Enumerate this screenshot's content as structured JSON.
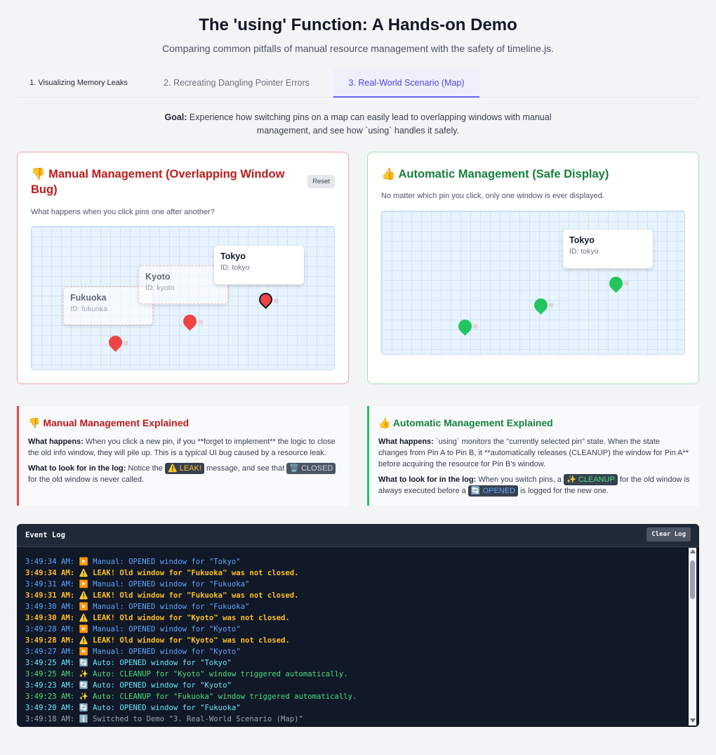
{
  "header": {
    "title": "The 'using' Function: A Hands-on Demo",
    "subtitle": "Comparing common pitfalls of manual resource management with the safety of timeline.js."
  },
  "tabs": [
    {
      "label": "1. Visualizing Memory Leaks",
      "active": false
    },
    {
      "label": "2. Recreating Dangling Pointer Errors",
      "active": false
    },
    {
      "label": "3. Real-World Scenario (Map)",
      "active": true
    }
  ],
  "goal": {
    "label": "Goal:",
    "text": "Experience how switching pins on a map can easily lead to overlapping windows with manual management, and see how `using` handles it safely."
  },
  "manual_card": {
    "icon": "thumbs-down-icon",
    "title": "👎 Manual Management (Overlapping Window Bug)",
    "reset_label": "Reset",
    "description": "What happens when you click pins one after another?",
    "windows": [
      {
        "name": "Fukuoka",
        "id": "ID: fukuoka"
      },
      {
        "name": "Kyoto",
        "id": "ID: kyoto"
      },
      {
        "name": "Tokyo",
        "id": "ID: tokyo"
      }
    ]
  },
  "auto_card": {
    "icon": "thumbs-up-icon",
    "title": "👍 Automatic Management (Safe Display)",
    "description": "No matter which pin you click, only one window is ever displayed.",
    "window": {
      "name": "Tokyo",
      "id": "ID: tokyo"
    }
  },
  "manual_explain": {
    "title": "👎 Manual Management Explained",
    "what_label": "What happens:",
    "what_text": "When you click a new pin, if you **forget to implement** the logic to close the old info window, they will pile up. This is a typical UI bug caused by a resource leak.",
    "look_label": "What to look for in the log:",
    "look_pre": "Notice the",
    "leak_tag": "⚠️ LEAK!",
    "look_mid": "message, and see that",
    "closed_tag": "🗑️ CLOSED",
    "look_post": "for the old window is never called."
  },
  "auto_explain": {
    "title": "👍 Automatic Management Explained",
    "what_label": "What happens:",
    "what_text": "`using` monitors the \"currently selected pin\" state. When the state changes from Pin A to Pin B, it **automatically releases (CLEANUP) the window for Pin A** before acquiring the resource for Pin B's window.",
    "look_label": "What to look for in the log:",
    "look_pre": "When you switch pins, a",
    "cleanup_tag": "✨ CLEANUP",
    "look_mid": "for the old window is always executed before a",
    "opened_tag": "🔄 OPENED",
    "look_post": "is logged for the new one."
  },
  "event_log": {
    "title": "Event Log",
    "clear_label": "Clear Log",
    "entries": [
      {
        "kind": "info",
        "text": "3:49:34 AM: ▶️ Manual: OPENED window for \"Tokyo\""
      },
      {
        "kind": "warn",
        "text": "3:49:34 AM: ⚠️ LEAK! Old window for \"Fukuoka\" was not closed."
      },
      {
        "kind": "info",
        "text": "3:49:31 AM: ▶️ Manual: OPENED window for \"Fukuoka\""
      },
      {
        "kind": "warn",
        "text": "3:49:31 AM: ⚠️ LEAK! Old window for \"Fukuoka\" was not closed."
      },
      {
        "kind": "info",
        "text": "3:49:30 AM: ▶️ Manual: OPENED window for \"Fukuoka\""
      },
      {
        "kind": "warn",
        "text": "3:49:30 AM: ⚠️ LEAK! Old window for \"Kyoto\" was not closed."
      },
      {
        "kind": "info",
        "text": "3:49:28 AM: ▶️ Manual: OPENED window for \"Kyoto\""
      },
      {
        "kind": "warn",
        "text": "3:49:28 AM: ⚠️ LEAK! Old window for \"Kyoto\" was not closed."
      },
      {
        "kind": "info",
        "text": "3:49:27 AM: ▶️ Manual: OPENED window for \"Kyoto\""
      },
      {
        "kind": "opened",
        "text": "3:49:25 AM: 🔄 Auto: OPENED window for \"Tokyo\""
      },
      {
        "kind": "cleanup",
        "text": "3:49:25 AM: ✨ Auto: CLEANUP for \"Kyoto\" window triggered automatically."
      },
      {
        "kind": "opened",
        "text": "3:49:23 AM: 🔄 Auto: OPENED window for \"Kyoto\""
      },
      {
        "kind": "cleanup",
        "text": "3:49:23 AM: ✨ Auto: CLEANUP for \"Fukuoka\" window triggered automatically."
      },
      {
        "kind": "opened",
        "text": "3:49:20 AM: 🔄 Auto: OPENED window for \"Fukuoka\""
      },
      {
        "kind": "system",
        "text": "3:49:18 AM: ℹ️ Switched to Demo \"3. Real-World Scenario (Map)\""
      }
    ]
  },
  "colors": {
    "manual_accent": "#ef4444",
    "auto_accent": "#22c55e",
    "tab_active": "#4f46e5",
    "log_background": "#111827"
  }
}
